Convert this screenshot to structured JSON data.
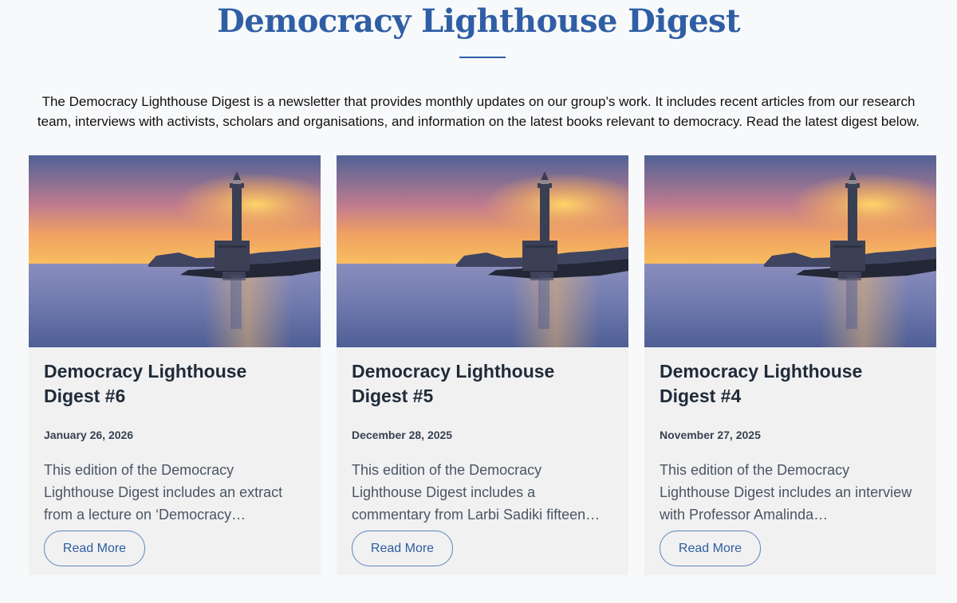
{
  "header": {
    "title": "Democracy Lighthouse Digest",
    "intro": "The Democracy Lighthouse Digest is a newsletter that provides monthly updates on our group’s work. It includes recent articles from our research team, interviews with activists, scholars and organisations, and information on the latest books relevant to democracy. Read the latest digest below."
  },
  "cards": [
    {
      "title": "Democracy Lighthouse Digest #6",
      "date": "January 26, 2026",
      "excerpt": "This edition of the Democracy Lighthouse Digest includes an extract from a lecture on ‘Democracy…",
      "button_label": "Read More"
    },
    {
      "title": "Democracy Lighthouse Digest #5",
      "date": "December 28, 2025",
      "excerpt": "This edition of the Democracy Lighthouse Digest includes a commentary from Larbi Sadiki fifteen…",
      "button_label": "Read More"
    },
    {
      "title": "Democracy Lighthouse Digest #4",
      "date": "November 27, 2025",
      "excerpt": "This edition of the Democracy Lighthouse Digest includes an interview with Professor Amalinda…",
      "button_label": "Read More"
    }
  ],
  "colors": {
    "accent": "#2f5ea4",
    "background": "#f8f9fb",
    "card_background": "#f1f1f2",
    "button_border": "#5c85bb"
  },
  "icons": {
    "card_image": "lighthouse-sunset-photo"
  }
}
